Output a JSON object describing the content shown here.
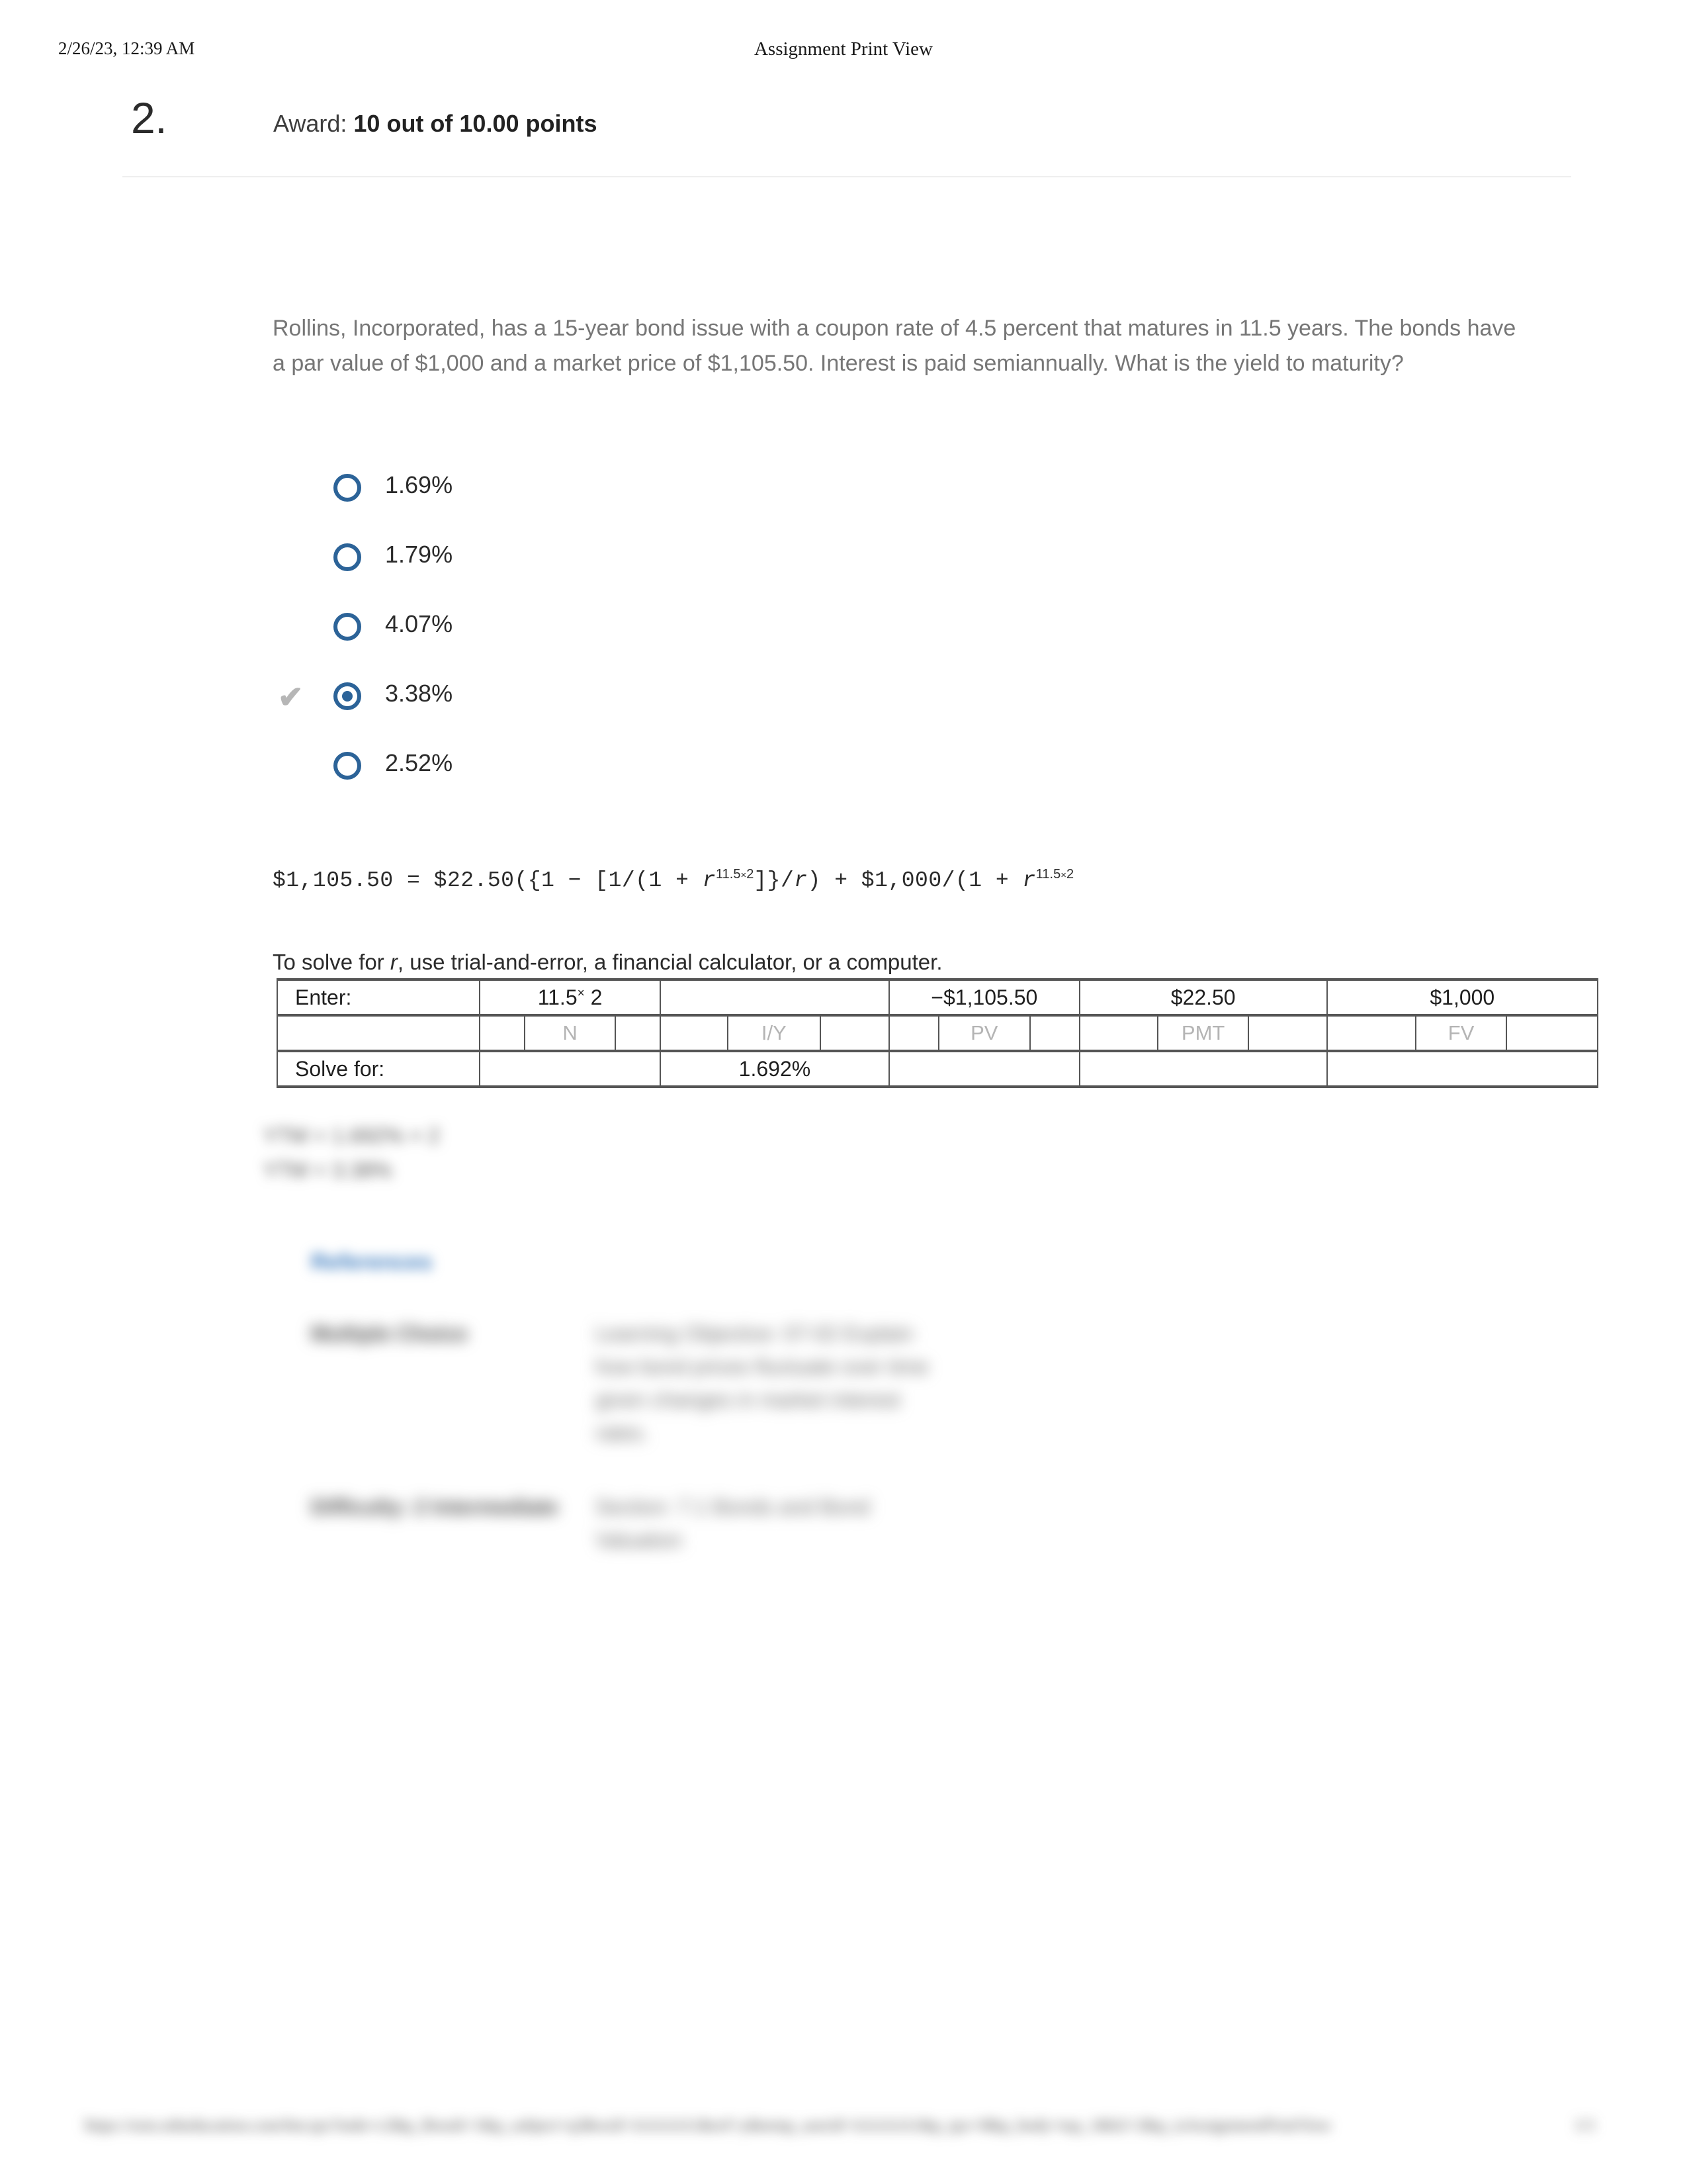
{
  "print_header": {
    "date": "2/26/23, 12:39 AM",
    "title": "Assignment Print View"
  },
  "question": {
    "number": "2.",
    "award_prefix": "Award: ",
    "award_value": "10 out of 10.00 points",
    "stem": "Rollins, Incorporated, has a 15-year bond issue with a coupon rate of 4.5 percent that matures in 11.5 years. The bonds have a par value of $1,000 and a market price of $1,105.50. Interest is paid semiannually. What is the yield to maturity?"
  },
  "choices": [
    {
      "label": "1.69%",
      "selected": false,
      "correct": false
    },
    {
      "label": "1.79%",
      "selected": false,
      "correct": false
    },
    {
      "label": "4.07%",
      "selected": false,
      "correct": false
    },
    {
      "label": "3.38%",
      "selected": true,
      "correct": true
    },
    {
      "label": "2.52%",
      "selected": false,
      "correct": false
    }
  ],
  "solution": {
    "formula_plain": "$1,105.50 = $22.50({1 − [1/(1 + r)^(11.5 × 2)]}/r) + $1,000/(1 + r)^(11.5 × 2)",
    "formula": {
      "lhs": "$1,105.50 = $22.50({1 − [1/(1 + ",
      "var1": "r",
      "exp1_base": "11.5",
      "exp1_times": "×",
      "exp1_pow": "2",
      "mid": "]}/",
      "var2": "r",
      "mid2": ") + $1,000/(1 + ",
      "var3": "r",
      "exp2_base": "11.5",
      "exp2_times": "×",
      "exp2_pow": "2"
    },
    "solve_note_pre": "To solve for ",
    "solve_note_var": "r",
    "solve_note_post": ", use trial-and-error, a financial calculator, or a computer."
  },
  "calc_table": {
    "row_enter_label": "Enter:",
    "row_solve_label": "Solve for:",
    "enter_values": {
      "n": {
        "base": "11.5",
        "times": "×",
        "power": "2"
      },
      "iy": "",
      "pv": "−$1,105.50",
      "pmt": "$22.50",
      "fv": "$1,000"
    },
    "field_labels": {
      "n": "N",
      "iy": "I/Y",
      "pv": "PV",
      "pmt": "PMT",
      "fv": "FV"
    },
    "solve_values": {
      "n": "",
      "iy": "1.692%",
      "pv": "",
      "pmt": "",
      "fv": ""
    }
  },
  "blurred": {
    "ytm_line_1": "YTM = 1.692% × 2",
    "ytm_line_2": "YTM = 3.38%",
    "references_link": "References",
    "meta": [
      {
        "key": "Multiple Choice",
        "value": "Learning Objective: 07-02 Explain how bond prices fluctuate over time given changes in market interest rates."
      },
      {
        "key": "Difficulty: 2 Intermediate",
        "value": "Section: 7.1 Bonds and Bond Valuation"
      }
    ],
    "footer_url": "https://ezto.mheducation.com/hm.tpx?todo=c2&p_Result=1&p_subject=q3&wid=AAAAA1&ref=y&temp_userid=AAAAA1&p_tpx=0&p_body=top_1&b2=2&p_isAssignmentPrintView",
    "footer_page": "1/1"
  },
  "colors": {
    "radio_blue": "#2c6398",
    "checkmark_gray": "#b6b6b6",
    "stem_gray": "#767676",
    "table_border": "#555555",
    "field_label_gray": "#b4b4b4",
    "link_blue": "#3b7bbf"
  }
}
